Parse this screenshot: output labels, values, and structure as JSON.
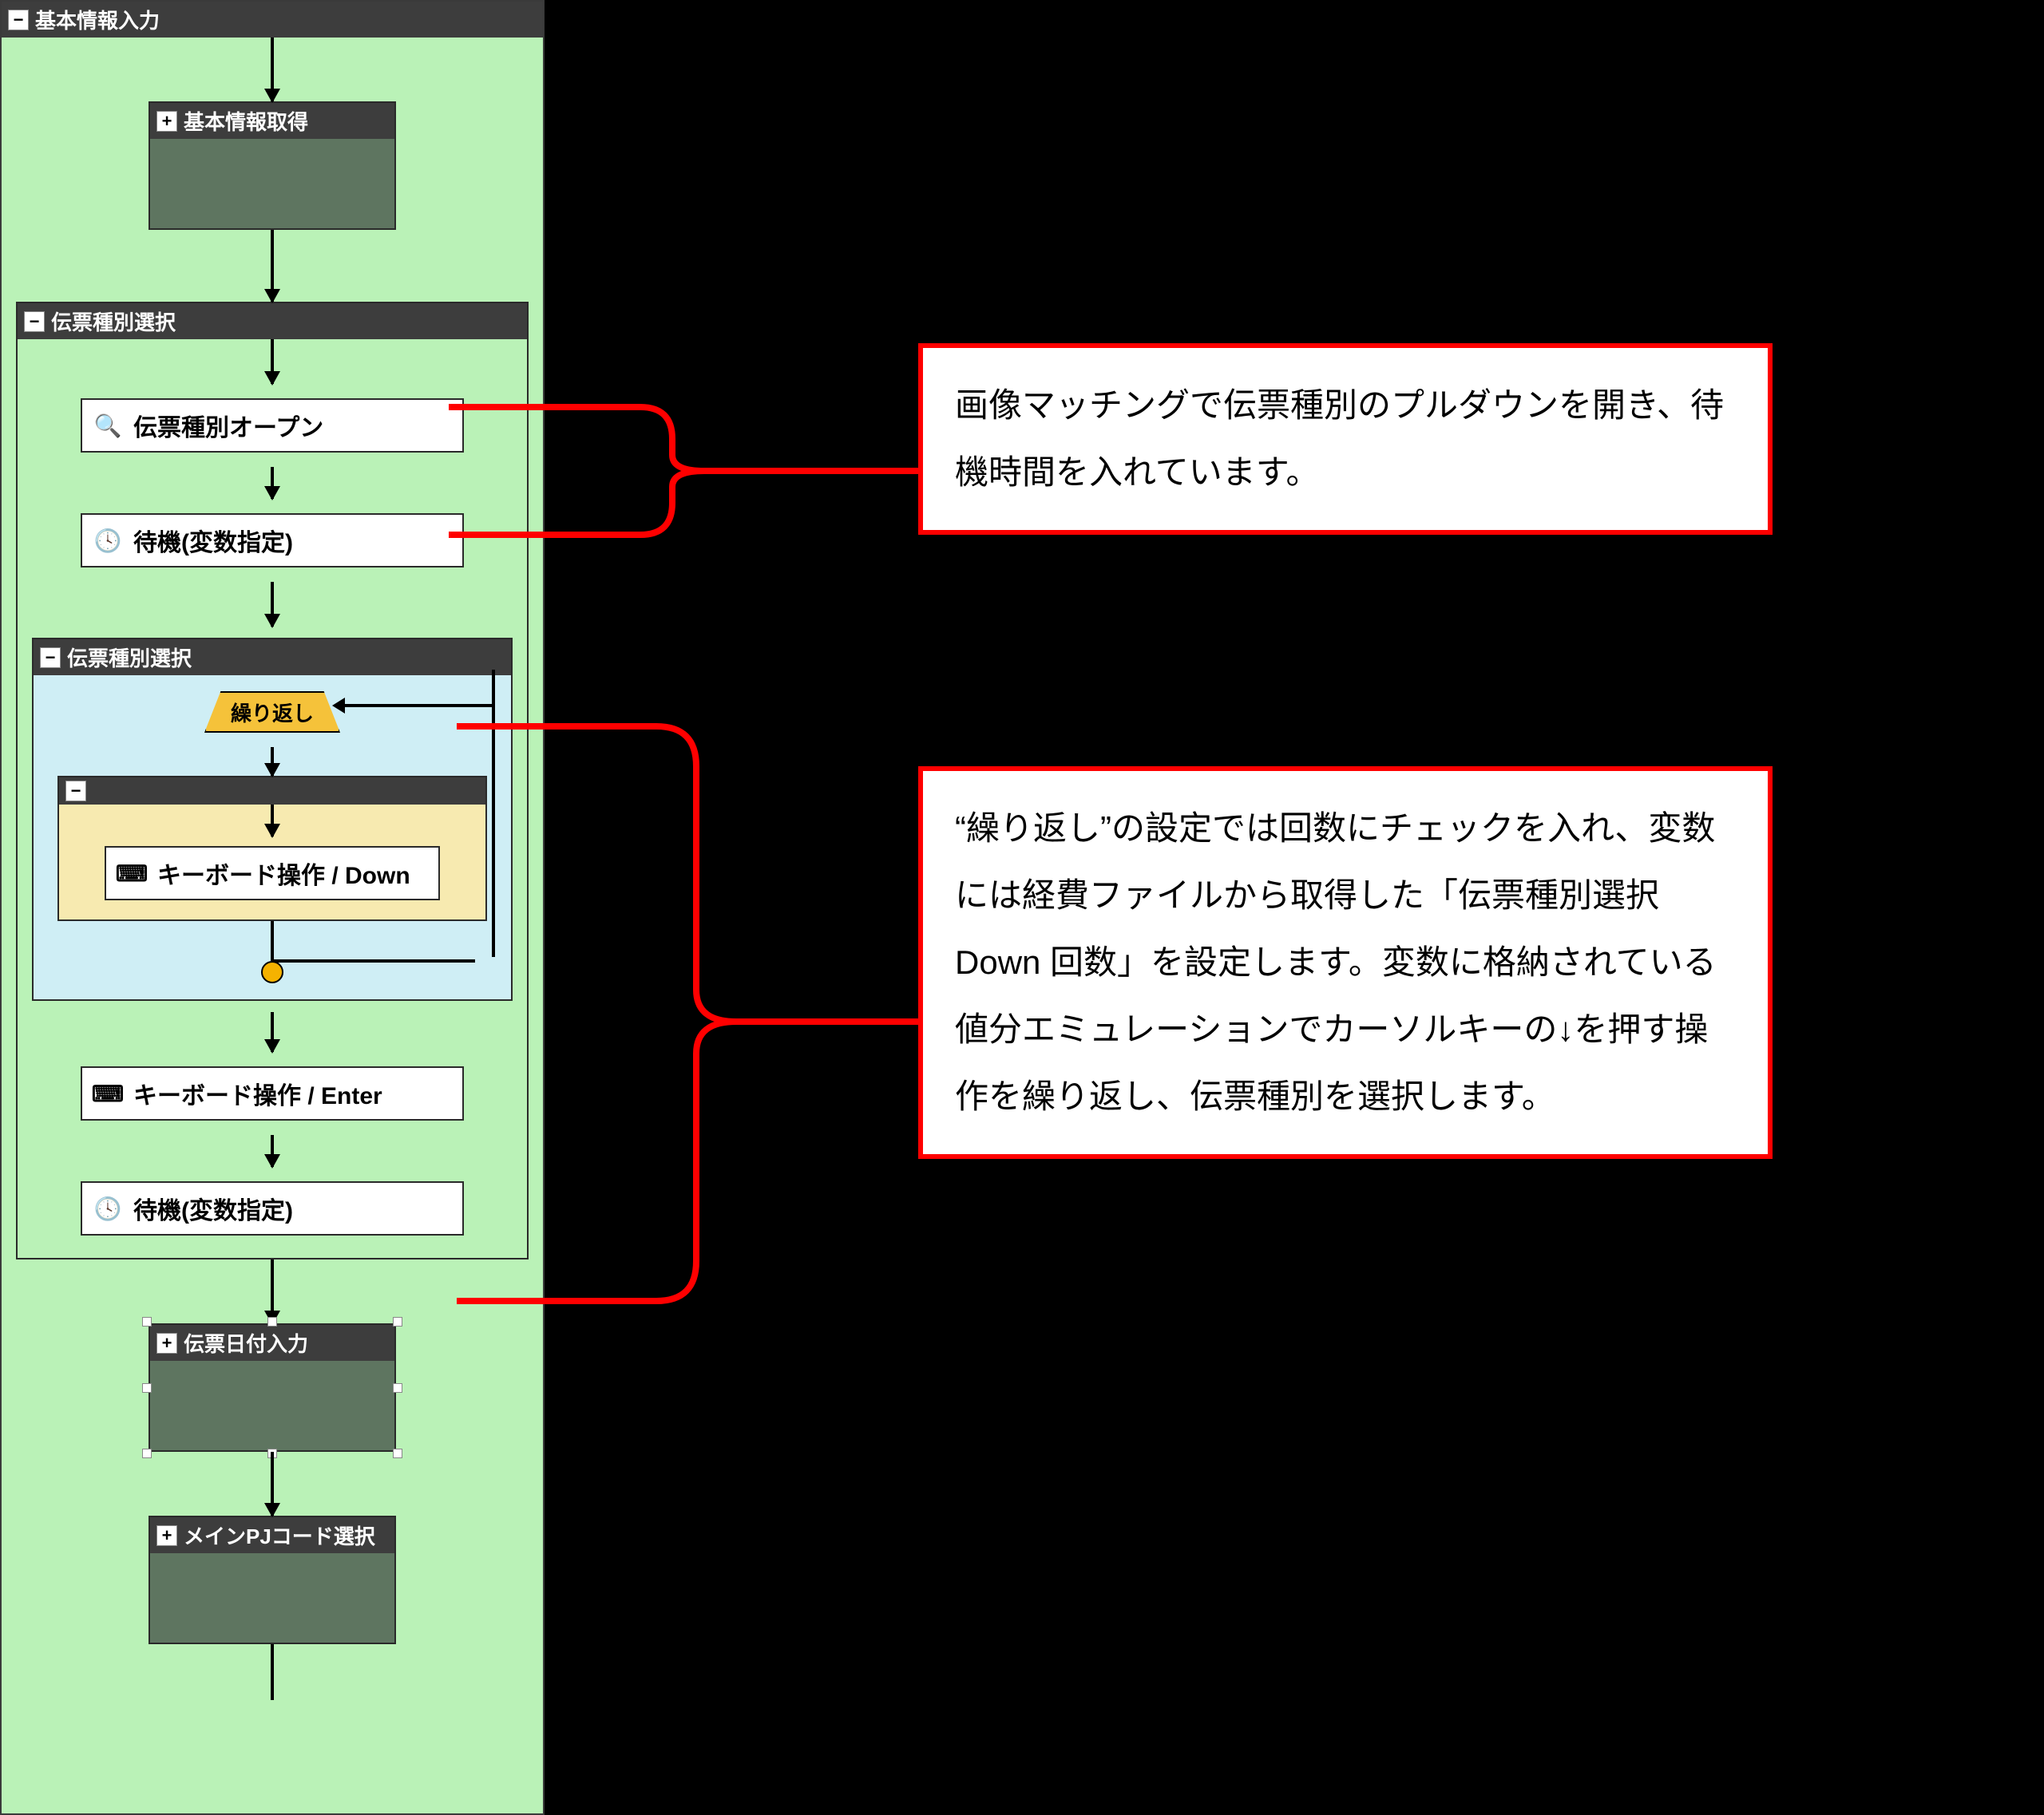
{
  "flow": {
    "root_header": "基本情報入力",
    "node_basic_info": "基本情報取得",
    "group_slip_select": "伝票種別選択",
    "step_open_slip": "伝票種別オープン",
    "step_wait1": "待機(変数指定)",
    "inner_group": "伝票種別選択",
    "loop_label": "繰り返し",
    "step_key_down": "キーボード操作 / Down",
    "step_key_enter": "キーボード操作 / Enter",
    "step_wait2": "待機(変数指定)",
    "node_date_input": "伝票日付入力",
    "node_main_pj": "メインPJコード選択"
  },
  "callouts": {
    "c1": "画像マッチングで伝票種別のプルダウンを開き、待機時間を入れています。",
    "c2": "“繰り返し”の設定では回数にチェックを入れ、変数には経費ファイルから取得した「伝票種別選択 Down 回数」を設定します。変数に格納されている値分エミュレーションでカーソルキーの↓を押す操作を繰り返し、伝票種別を選択します。"
  },
  "icons": {
    "minus": "−",
    "plus": "+",
    "search": "🔍",
    "clock": "🕓",
    "keyboard": "⌨"
  }
}
